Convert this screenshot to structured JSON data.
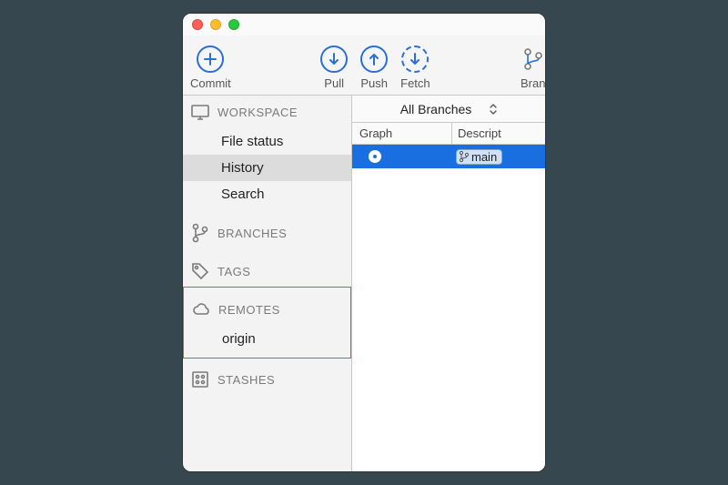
{
  "toolbar": {
    "commit": "Commit",
    "pull": "Pull",
    "push": "Push",
    "fetch": "Fetch",
    "branch": "Branch"
  },
  "sidebar": {
    "workspace": {
      "title": "WORKSPACE",
      "file_status": "File status",
      "history": "History",
      "search": "Search"
    },
    "branches": {
      "title": "BRANCHES"
    },
    "tags": {
      "title": "TAGS"
    },
    "remotes": {
      "title": "REMOTES",
      "origin": "origin"
    },
    "stashes": {
      "title": "STASHES"
    }
  },
  "main": {
    "filter": "All Branches",
    "columns": {
      "graph": "Graph",
      "desc": "Description"
    },
    "row0": {
      "branch": "main"
    }
  }
}
